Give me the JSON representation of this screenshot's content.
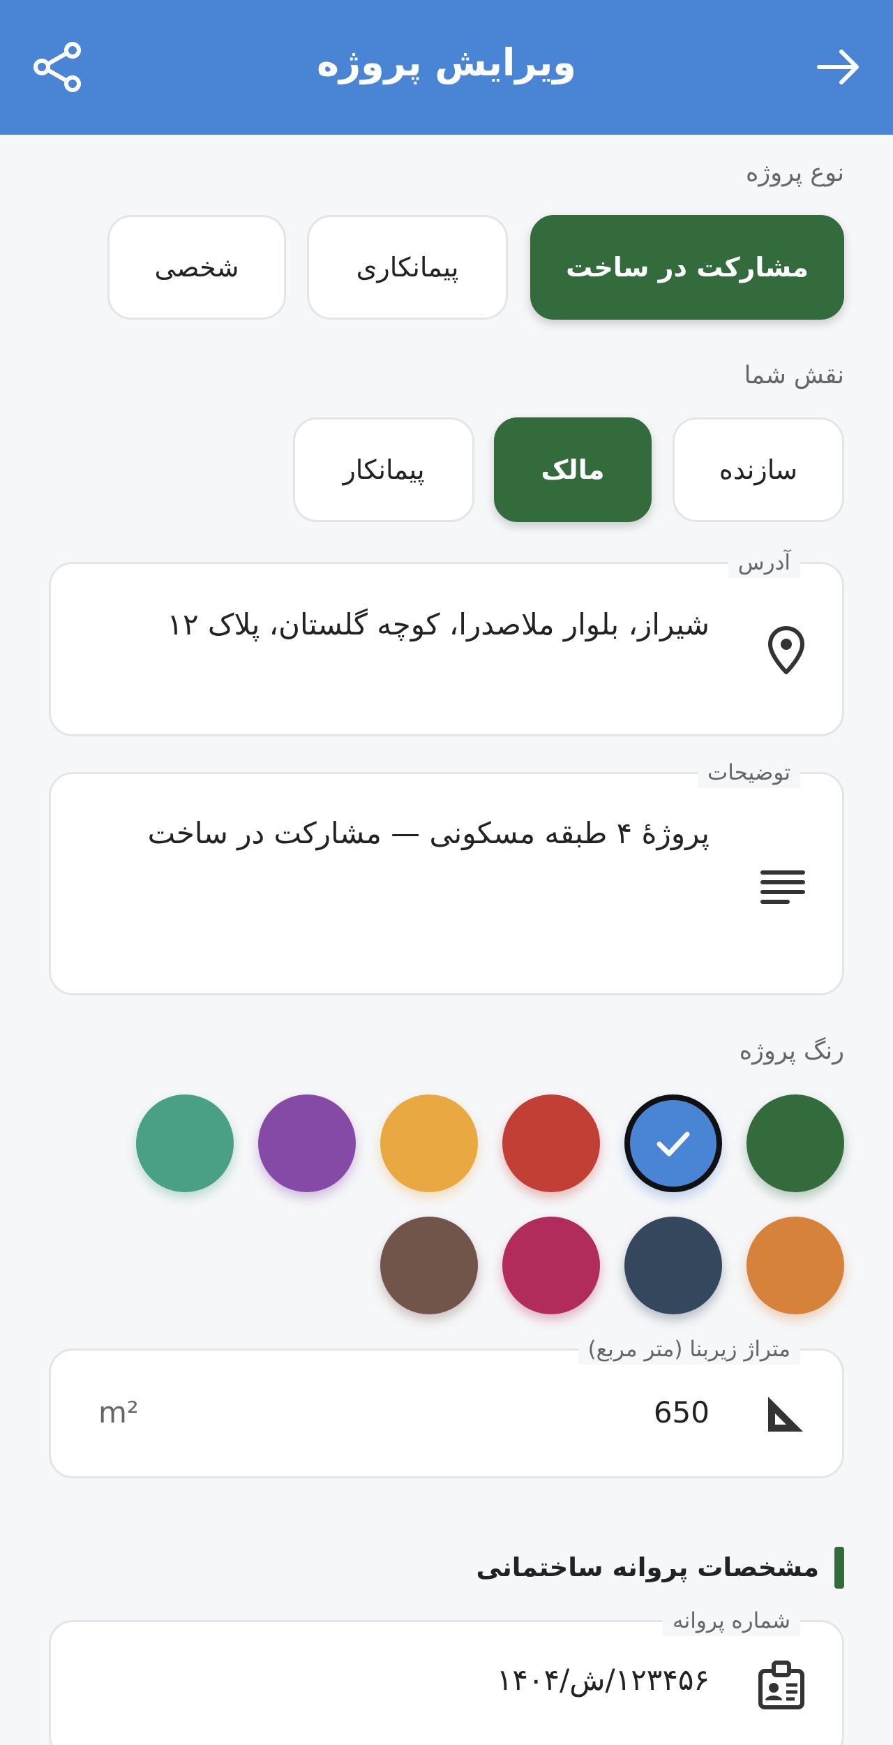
{
  "appbar": {
    "title": "ویرایش پروژه",
    "back_icon": "arrow-forward-icon",
    "share_icon": "share-icon",
    "color": "#4a84d4"
  },
  "project_type": {
    "label": "نوع پروژه",
    "options": [
      "مشارکت در ساخت",
      "پیمانکاری",
      "شخصی"
    ],
    "selected": "مشارکت در ساخت"
  },
  "role": {
    "label": "نقش شما",
    "options": [
      "سازنده",
      "مالک",
      "پیمانکار"
    ],
    "selected": "مالک"
  },
  "address": {
    "label": "آدرس",
    "value": "شیراز، بلوار ملاصدرا، کوچه گلستان، پلاک ۱۲",
    "icon": "location-pin-icon"
  },
  "description": {
    "label": "توضیحات",
    "value": "پروژهٔ ۴ طبقه مسکونی — مشارکت در ساخت",
    "icon": "notes-icon"
  },
  "color_picker": {
    "label": "رنگ پروژه",
    "colors": [
      "#336b3d",
      "#4a84d4",
      "#c23f35",
      "#e9a842",
      "#8549a6",
      "#49a087",
      "#d6823a",
      "#35475d",
      "#b12b5c",
      "#71544a"
    ],
    "selected": "#4a84d4",
    "accent": "#336b3d"
  },
  "area": {
    "label": "متراژ زیربنا (متر مربع)",
    "value": "650",
    "unit": "m²",
    "icon": "ruler-triangle-icon"
  },
  "permit": {
    "heading": "مشخصات پروانه ساختمانی",
    "number_label": "شماره پروانه",
    "number_value": "۱۲۳۴۵۶/ش/۱۴۰۴",
    "icon": "id-badge-icon"
  }
}
